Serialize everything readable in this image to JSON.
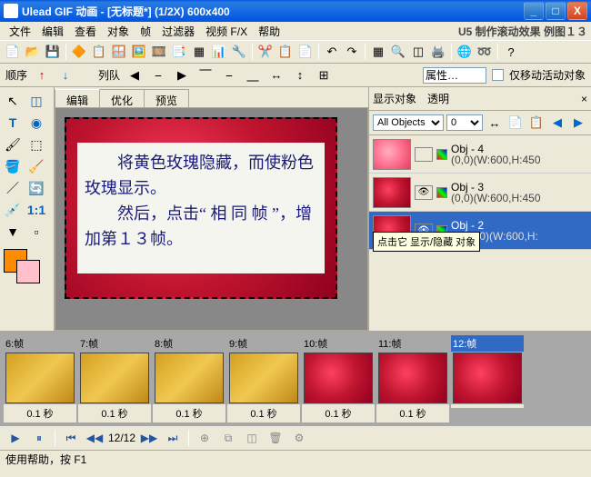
{
  "window": {
    "title": "Ulead GIF 动画 - [无标题*] (1/2X)   600x400",
    "min": "_",
    "max": "□",
    "close": "X"
  },
  "menu": [
    "文件",
    "编辑",
    "查看",
    "对象",
    "帧",
    "过滤器",
    "视频 F/X",
    "帮助"
  ],
  "menu_hint": "U5 制作滚动效果 例图１３",
  "seqbar": {
    "order": "顺序",
    "queue": "列队",
    "attr_label": "属性…",
    "move_checkbox": "仅移动活动对象"
  },
  "tabs": {
    "edit": "编辑",
    "optimize": "优化",
    "preview": "预览"
  },
  "canvas_text": "　　将黄色玫瑰隐藏，而使粉色玫瑰显示。\n　　然后，点击“ 相 同 帧 ”，增加第１３帧。",
  "right_panel": {
    "show_obj": "显示对象",
    "transparent": "透明",
    "all_objects": "All Objects",
    "zero": "0",
    "objects": [
      {
        "name": "Obj - 4",
        "coords": "(0,0)(W:600,H:450",
        "kind": "pink"
      },
      {
        "name": "Obj - 3",
        "coords": "(0,0)(W:600,H:450",
        "kind": "red"
      },
      {
        "name": "Obj - 2",
        "coords": "(-600,0)(W:600,H:",
        "kind": "red",
        "selected": true
      }
    ],
    "tooltip": "点击它 显示/隐藏 对象"
  },
  "frames": [
    {
      "label": "6:帧",
      "time": "0.1 秒",
      "kind": "yellow"
    },
    {
      "label": "7:帧",
      "time": "0.1 秒",
      "kind": "yellow"
    },
    {
      "label": "8:帧",
      "time": "0.1 秒",
      "kind": "yellow"
    },
    {
      "label": "9:帧",
      "time": "0.1 秒",
      "kind": "yellow"
    },
    {
      "label": "10:帧",
      "time": "0.1 秒",
      "kind": "red"
    },
    {
      "label": "11:帧",
      "time": "0.1 秒",
      "kind": "red"
    },
    {
      "label": "12:帧",
      "time": "",
      "kind": "red",
      "selected": true
    }
  ],
  "playback": {
    "counter": "12/12"
  },
  "statusbar": "使用帮助，按 F1"
}
